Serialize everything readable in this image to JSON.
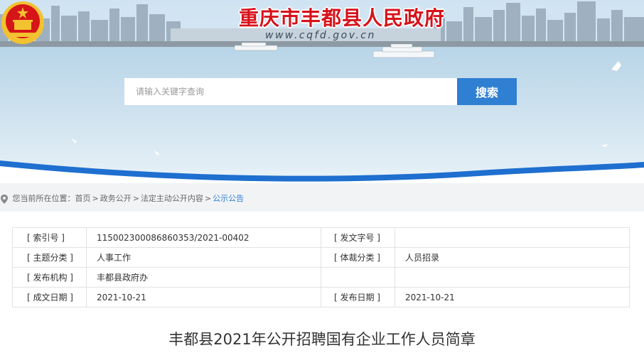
{
  "header": {
    "site_title": "重庆市丰都县人民政府",
    "site_url": "www.cqfd.gov.cn"
  },
  "search": {
    "placeholder": "请输入关键字查询",
    "button_label": "搜索"
  },
  "breadcrumb": {
    "prefix": "您当前所在位置：",
    "items": [
      "首页",
      "政务公开",
      "法定主动公开内容",
      "公示公告"
    ],
    "separator": ">"
  },
  "meta": {
    "rows": [
      {
        "label1": "[ 索引号 ]",
        "value1": "115002300086860353/2021-00402",
        "label2": "[ 发文字号 ]",
        "value2": ""
      },
      {
        "label1": "[ 主题分类 ]",
        "value1": "人事工作",
        "label2": "[ 体裁分类 ]",
        "value2": "人员招录"
      },
      {
        "label1": "[ 发布机构 ]",
        "value1": "丰都县政府办",
        "label2": "",
        "value2": ""
      },
      {
        "label1": "[ 成文日期 ]",
        "value1": "2021-10-21",
        "label2": "[ 发布日期 ]",
        "value2": "2021-10-21"
      }
    ]
  },
  "article": {
    "title": "丰都县2021年公开招聘国有企业工作人员简章"
  },
  "colors": {
    "accent_blue": "#2f7fd3",
    "title_red": "#d7121b",
    "emblem_red": "#d61518",
    "emblem_gold": "#f3c230"
  },
  "icons": [
    "national-emblem-icon",
    "location-pin-icon"
  ]
}
